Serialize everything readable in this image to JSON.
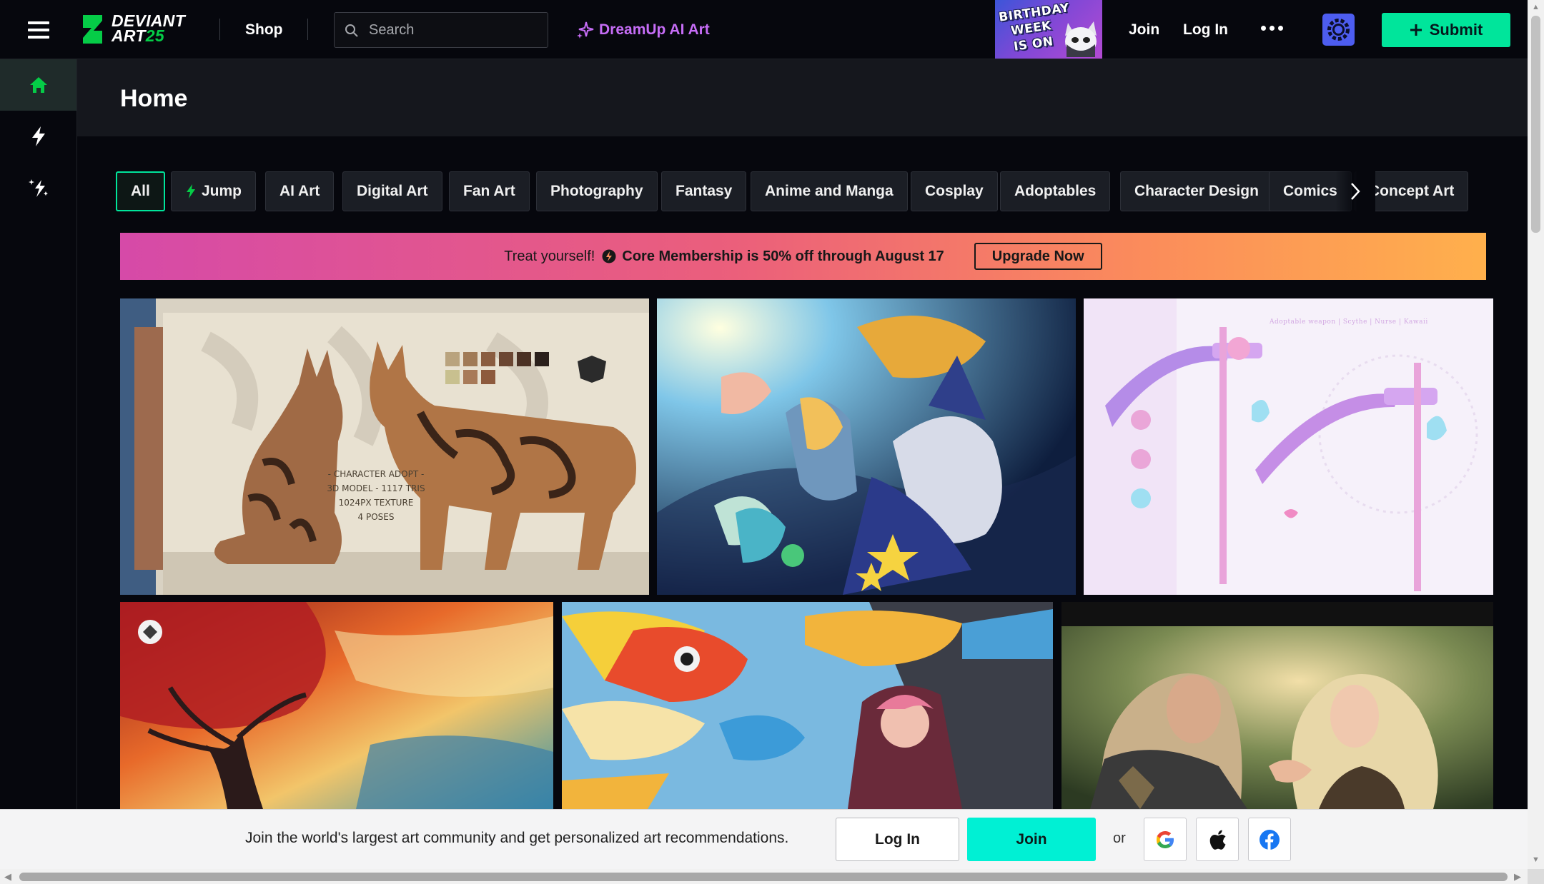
{
  "header": {
    "logo_line1": "DEVIANT",
    "logo_line2": "ART",
    "logo_number": "25",
    "shop": "Shop",
    "search_placeholder": "Search",
    "dreamup": "DreamUp AI Art",
    "birthday_banner": [
      "BIRTHDAY",
      "WEEK",
      "IS ON"
    ],
    "join": "Join",
    "login": "Log In",
    "submit": "Submit"
  },
  "sidebar": {
    "items": [
      {
        "icon": "home-icon",
        "active": true
      },
      {
        "icon": "lightning-icon",
        "active": false
      },
      {
        "icon": "sparkle-icon",
        "active": false
      }
    ]
  },
  "page": {
    "title": "Home"
  },
  "categories": [
    "All",
    "Jump",
    "AI Art",
    "Digital Art",
    "Fan Art",
    "Photography",
    "Fantasy",
    "Anime and Manga",
    "Cosplay",
    "Adoptables",
    "Character Design",
    "Comics",
    "Concept Art"
  ],
  "promo": {
    "lead": "Treat yourself!",
    "message": "Core Membership is 50% off through August 17",
    "button": "Upgrade Now"
  },
  "gallery": {
    "adopt_caption": [
      "- CHARACTER ADOPT -",
      "3D MODEL - 1117 TRIS",
      "1024PX TEXTURE",
      "4 POSES"
    ],
    "scythe_caption": "Adoptable weapon | Scythe | Nurse | Kawaii"
  },
  "join_bar": {
    "text": "Join the world's largest art community and get personalized art recommendations.",
    "login": "Log In",
    "join": "Join",
    "or": "or"
  },
  "colors": {
    "brand_green": "#00e59b",
    "join_teal": "#00f0d4",
    "dreamup_purple": "#c66df6",
    "promo_gradient_start": "#d64aa8",
    "promo_gradient_end": "#ffb04c"
  }
}
